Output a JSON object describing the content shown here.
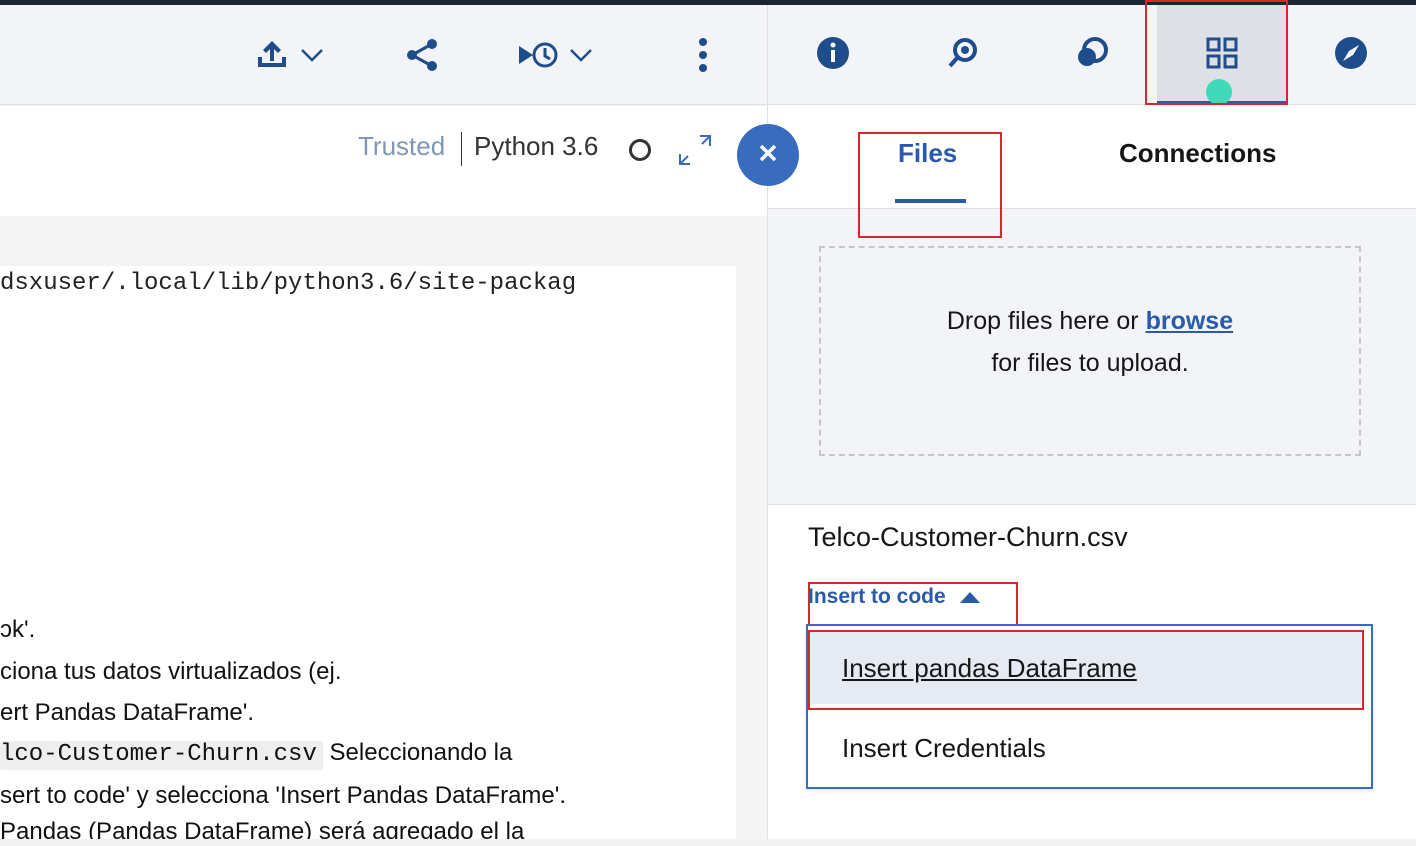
{
  "toolbar": {
    "icons": [
      "upload-icon",
      "share-icon",
      "schedule-icon",
      "more-icon"
    ]
  },
  "notebook": {
    "trusted": "Trusted",
    "kernel": "Python 3.6",
    "code_line": "dsxuser/.local/lib/python3.6/site-packag",
    "md_lines": {
      "l1": "ɔk'.",
      "l2": "ciona tus datos virtualizados (ej.",
      "l3": "ert Pandas DataFrame'.",
      "l4_code": "lco-Customer-Churn.csv",
      "l4_text": " Seleccionando la",
      "l5": "sert to code' y selecciona 'Insert Pandas DataFrame'.",
      "l6": "Pandas (Pandas DataFrame) será agregado el la"
    }
  },
  "right_panel": {
    "toolbar_icons": [
      "info-icon",
      "find-icon",
      "comments-icon",
      "data-assets-icon",
      "compass-icon"
    ],
    "tabs": {
      "files": "Files",
      "connections": "Connections"
    },
    "drop": {
      "line1_prefix": "Drop files here or ",
      "browse": "browse",
      "line2": "for files to upload."
    },
    "file": {
      "name": "Telco-Customer-Churn.csv",
      "insert_to_code": "Insert to code"
    },
    "menu": {
      "item1": "Insert pandas DataFrame",
      "item2": "Insert Credentials"
    }
  },
  "colors": {
    "accent": "#2a5aa8",
    "highlight_box": "#d9262a",
    "status_dot": "#3ddbb8"
  }
}
